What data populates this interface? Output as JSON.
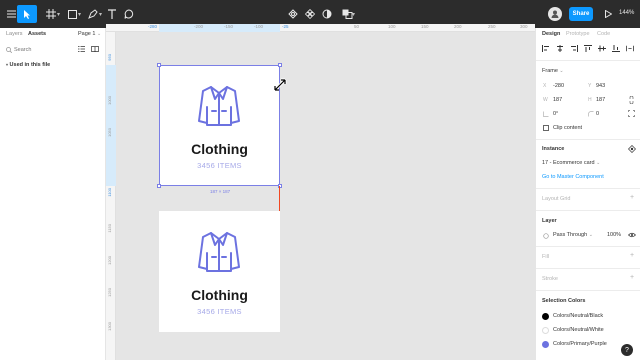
{
  "toolbar": {
    "share_label": "Share",
    "zoom_level": "144%"
  },
  "left_panel": {
    "tabs": [
      "Layers",
      "Assets"
    ],
    "page_label": "Page 1",
    "search_placeholder": "Search",
    "used_in_file": "Used in this file"
  },
  "rulers": {
    "top": [
      "-280",
      "-200",
      "-150",
      "-100",
      "-50",
      "-25",
      "50",
      "100",
      "150",
      "200",
      "250",
      "300"
    ],
    "left": [
      "900",
      "950",
      "1000",
      "1050",
      "1100",
      "1150",
      "1200",
      "1250",
      "1300",
      "1350"
    ]
  },
  "cards": [
    {
      "title": "Clothing",
      "subtitle": "3456 ITEMS"
    },
    {
      "title": "Clothing",
      "subtitle": "3456 ITEMS"
    }
  ],
  "selection": {
    "size_label": "187 × 187"
  },
  "right_panel": {
    "tabs": [
      "Design",
      "Prototype",
      "Code"
    ],
    "frame_label": "Frame",
    "x_label": "X",
    "x_value": "-280",
    "y_label": "Y",
    "y_value": "943",
    "w_label": "W",
    "w_value": "187",
    "h_label": "H",
    "h_value": "187",
    "rotation_value": "0°",
    "radius_value": "0",
    "clip_content": "Clip content",
    "instance_title": "Instance",
    "instance_name": "17 - Ecommerce card",
    "master_link": "Go to Master Component",
    "layout_grid": "Layout Grid",
    "layer_title": "Layer",
    "blend_mode": "Pass Through",
    "opacity": "100%",
    "fill": "Fill",
    "stroke": "Stroke",
    "selection_colors": "Selection Colors",
    "colors": [
      {
        "name": "Colors/Neutral/Black",
        "hex": "#000000"
      },
      {
        "name": "Colors/Neutral/White",
        "hex": "#ffffff"
      },
      {
        "name": "Colors/Primary/Purple",
        "hex": "#6c72e0"
      }
    ]
  },
  "accent": "#0d99ff",
  "icon_color": "#6c72e0"
}
